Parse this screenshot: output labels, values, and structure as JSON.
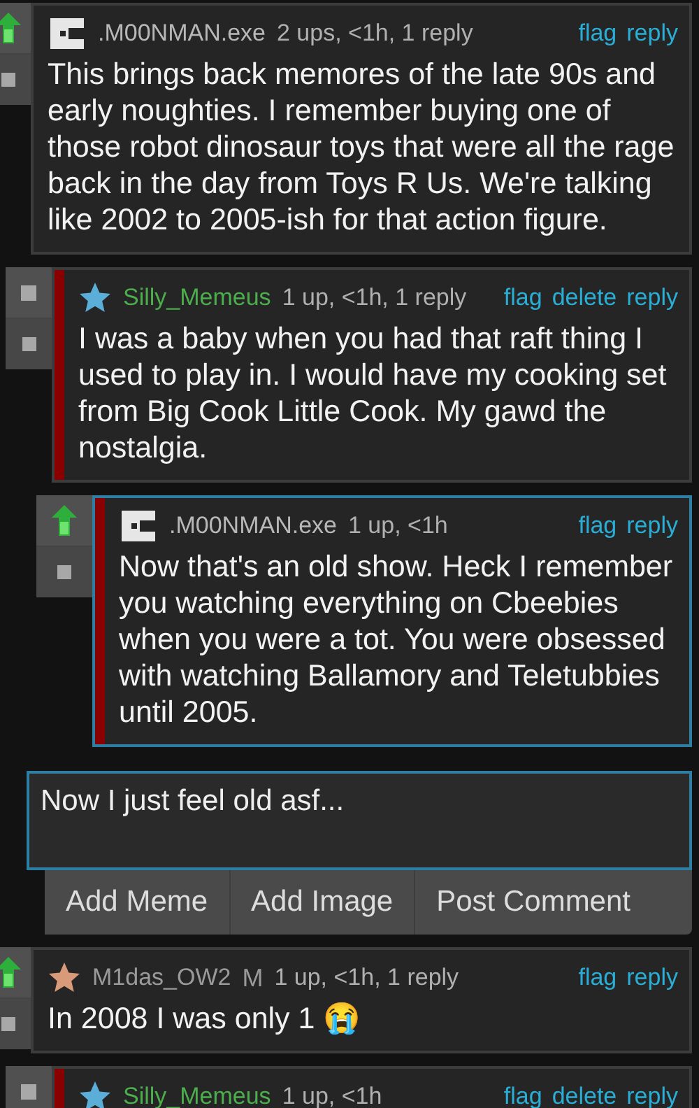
{
  "comments": [
    {
      "avatar": {
        "kind": "pixel"
      },
      "author": {
        "name": ".M00NMAN.exe",
        "color": "#b8b8b8"
      },
      "meta": "2 ups, <1h, 1 reply",
      "upvoted": true,
      "highlighted": false,
      "actions": [
        "flag",
        "reply"
      ],
      "text": "This brings back memores of the late 90s and early noughties. I remember buying one of those robot dinosaur toys that were all the rage back in the day from Toys R Us. We're talking like 2002 to 2005-ish for that action figure.",
      "children": [
        {
          "avatar": {
            "kind": "star",
            "color": "#5aaed8"
          },
          "author": {
            "name": "Silly_Memeus",
            "color": "#4cae4c"
          },
          "meta": "1 up, <1h, 1 reply",
          "upvoted": false,
          "highlighted": false,
          "actions": [
            "flag",
            "delete",
            "reply"
          ],
          "text": "I was a baby when you had that raft thing I used to play in. I would have my cooking set from Big Cook Little Cook. My gawd the nostalgia.",
          "children": [
            {
              "avatar": {
                "kind": "pixel"
              },
              "author": {
                "name": ".M00NMAN.exe",
                "color": "#b8b8b8"
              },
              "meta": "1 up, <1h",
              "upvoted": true,
              "highlighted": true,
              "actions": [
                "flag",
                "reply"
              ],
              "text": "Now that's an old show. Heck I remember you watching everything on Cbeebies when you were a tot. You were obsessed with watching Ballamory and Teletubbies until 2005.",
              "reply_box": {
                "value": "Now I just feel old asf...",
                "buttons": [
                  "Add Meme",
                  "Add Image",
                  "Post Comment"
                ]
              }
            }
          ]
        }
      ]
    },
    {
      "avatar": {
        "kind": "star",
        "color": "#d89a78"
      },
      "author": {
        "name": "M1das_OW2",
        "color": "#9a9a9a"
      },
      "badge": "M",
      "meta": "1 up, <1h, 1 reply",
      "upvoted": true,
      "highlighted": false,
      "actions": [
        "flag",
        "reply"
      ],
      "text": "In 2008 I was only 1 😭",
      "children": [
        {
          "avatar": {
            "kind": "star",
            "color": "#5aaed8"
          },
          "author": {
            "name": "Silly_Memeus",
            "color": "#4cae4c"
          },
          "meta": "1 up, <1h",
          "upvoted": false,
          "highlighted": false,
          "actions": [
            "flag",
            "delete",
            "reply"
          ]
        }
      ]
    }
  ]
}
